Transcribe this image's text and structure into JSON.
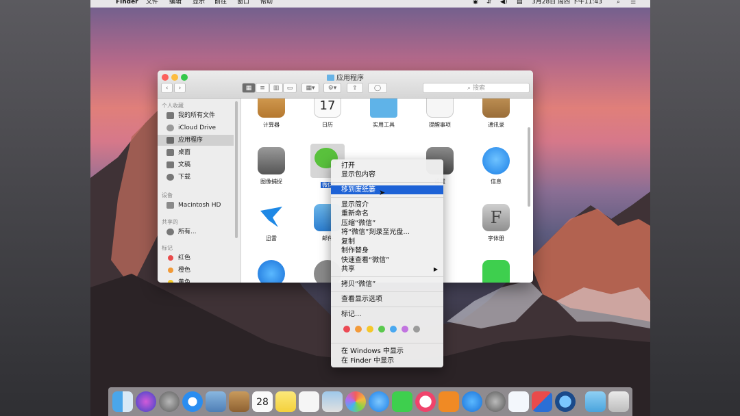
{
  "menubar": {
    "app_name": "Finder",
    "items": [
      "文件",
      "编辑",
      "显示",
      "前往",
      "窗口",
      "帮助"
    ],
    "clock": "3月28日 周四 下午11:43"
  },
  "window": {
    "title": "应用程序",
    "search_placeholder": "搜索"
  },
  "sidebar": {
    "sections": [
      {
        "heading": "个人收藏",
        "items": [
          "我的所有文件",
          "iCloud Drive",
          "应用程序",
          "桌面",
          "文稿",
          "下载"
        ]
      },
      {
        "heading": "设备",
        "items": [
          "Macintosh HD"
        ]
      },
      {
        "heading": "共享的",
        "items": [
          "所有..."
        ]
      },
      {
        "heading": "标记",
        "items": [
          "红色",
          "橙色",
          "黄色"
        ]
      }
    ],
    "selected": "应用程序",
    "tag_colors": [
      "#e94b4b",
      "#f19a38",
      "#f5c928"
    ]
  },
  "apps": {
    "row1": [
      "计算器",
      "日历",
      "实用工具",
      "提醒事项",
      "通讯录"
    ],
    "row2": [
      "图像捕捉",
      "微信",
      "",
      "设置",
      "信息"
    ],
    "row3": [
      "迅雷",
      "邮件",
      "",
      "",
      "字体册"
    ],
    "calendar_day": "17"
  },
  "context_menu": {
    "group1": [
      "打开",
      "显示包内容"
    ],
    "highlighted": "移到废纸篓",
    "group2": [
      "显示简介",
      "重新命名",
      "压缩“微信”",
      "将“微信”刻录至光盘...",
      "复制",
      "制作替身",
      "快速查看“微信”",
      "共享"
    ],
    "copy_item": "拷贝“微信”",
    "view_options": "查看显示选项",
    "tags_item": "标记...",
    "tag_colors": [
      "#ec4a55",
      "#f39a3a",
      "#f5c72a",
      "#5bc94f",
      "#4aa8f0",
      "#c274e0",
      "#9b9b9b"
    ],
    "group3": [
      "在 Windows 中显示",
      "在 Finder 中显示"
    ],
    "submenu_arrow": "▶"
  },
  "dock": {
    "calendar_day": "28"
  }
}
